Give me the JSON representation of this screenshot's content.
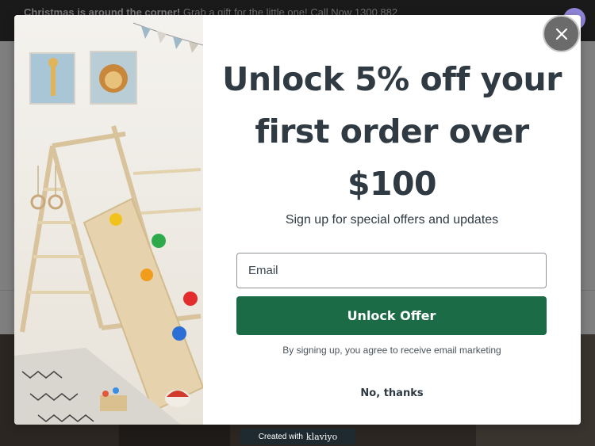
{
  "announcement": {
    "bold": "Christmas is around the corner!",
    "text": " Grab a gift for the little one! Call Now 1300 882"
  },
  "account_icon": {
    "icon": "user-avatar-icon",
    "glyph": "Q"
  },
  "popup": {
    "headline_line1": "Unlock 5% off your",
    "headline_line2": "first order over",
    "headline_line3": "$100",
    "subhead": "Sign up for special offers and updates",
    "email_placeholder": "Email",
    "unlock_label": "Unlock Offer",
    "consent": "By signing up, you agree to receive email marketing",
    "decline_label": "No, thanks",
    "close_icon": "close-icon"
  },
  "badge": {
    "prefix": "Created with",
    "brand": "klaviyo"
  },
  "colors": {
    "accent_green": "#1c6b47",
    "headline_text": "#2f3a43",
    "badge_bg": "#1f2a30",
    "avatar_purple": "#8f86d9"
  }
}
